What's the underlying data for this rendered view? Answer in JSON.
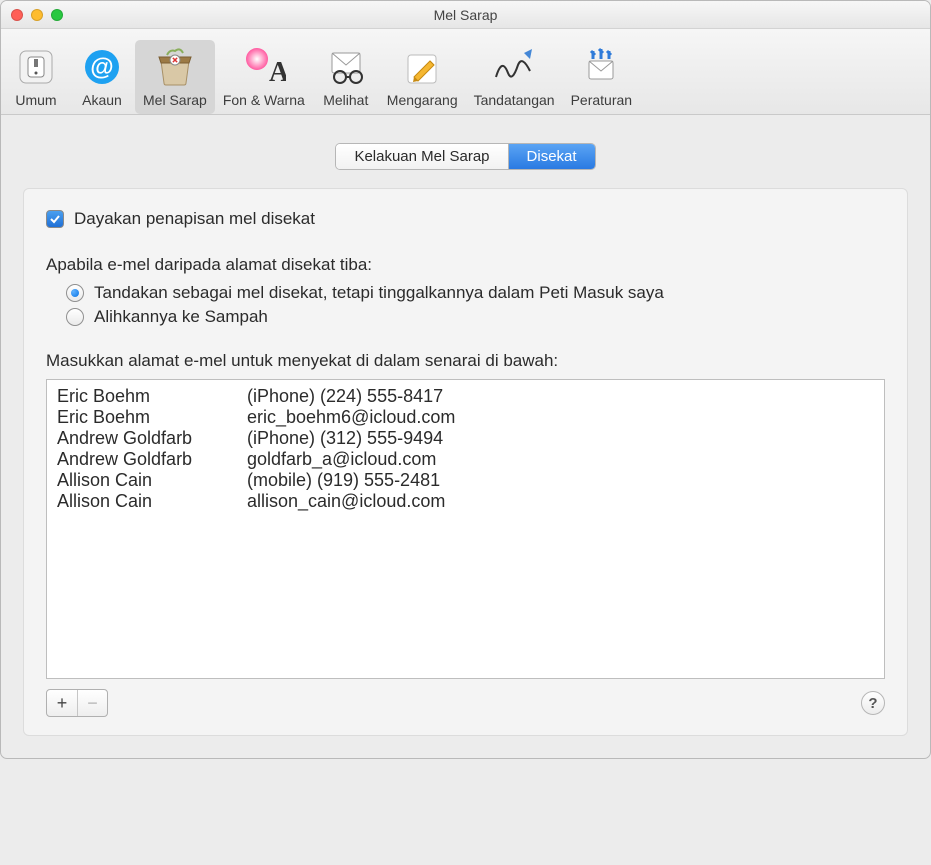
{
  "window": {
    "title": "Mel Sarap"
  },
  "toolbar": {
    "items": [
      {
        "label": "Umum",
        "name": "general"
      },
      {
        "label": "Akaun",
        "name": "accounts"
      },
      {
        "label": "Mel Sarap",
        "name": "junk",
        "active": true
      },
      {
        "label": "Fon & Warna",
        "name": "fonts"
      },
      {
        "label": "Melihat",
        "name": "viewing"
      },
      {
        "label": "Mengarang",
        "name": "composing"
      },
      {
        "label": "Tandatangan",
        "name": "signatures"
      },
      {
        "label": "Peraturan",
        "name": "rules"
      }
    ]
  },
  "tabs": {
    "items": [
      {
        "label": "Kelakuan Mel Sarap",
        "selected": false
      },
      {
        "label": "Disekat",
        "selected": true
      }
    ]
  },
  "checkbox": {
    "label": "Dayakan penapisan mel disekat",
    "checked": true
  },
  "section1": {
    "label": "Apabila e-mel daripada alamat disekat tiba:",
    "options": [
      {
        "label": "Tandakan sebagai mel disekat, tetapi tinggalkannya dalam Peti Masuk saya",
        "selected": true
      },
      {
        "label": "Alihkannya ke Sampah",
        "selected": false
      }
    ]
  },
  "section2": {
    "label": "Masukkan alamat e-mel untuk menyekat di dalam senarai di bawah:"
  },
  "blocked": [
    {
      "name": "Eric Boehm",
      "contact": "(iPhone) (224) 555-8417"
    },
    {
      "name": "Eric Boehm",
      "contact": "eric_boehm6@icloud.com"
    },
    {
      "name": "Andrew Goldfarb",
      "contact": "(iPhone) (312) 555-9494"
    },
    {
      "name": "Andrew Goldfarb",
      "contact": "goldfarb_a@icloud.com"
    },
    {
      "name": "Allison Cain",
      "contact": "(mobile) (919) 555-2481"
    },
    {
      "name": "Allison Cain",
      "contact": "allison_cain@icloud.com"
    }
  ],
  "footer": {
    "add": "+",
    "remove": "−",
    "help": "?"
  }
}
